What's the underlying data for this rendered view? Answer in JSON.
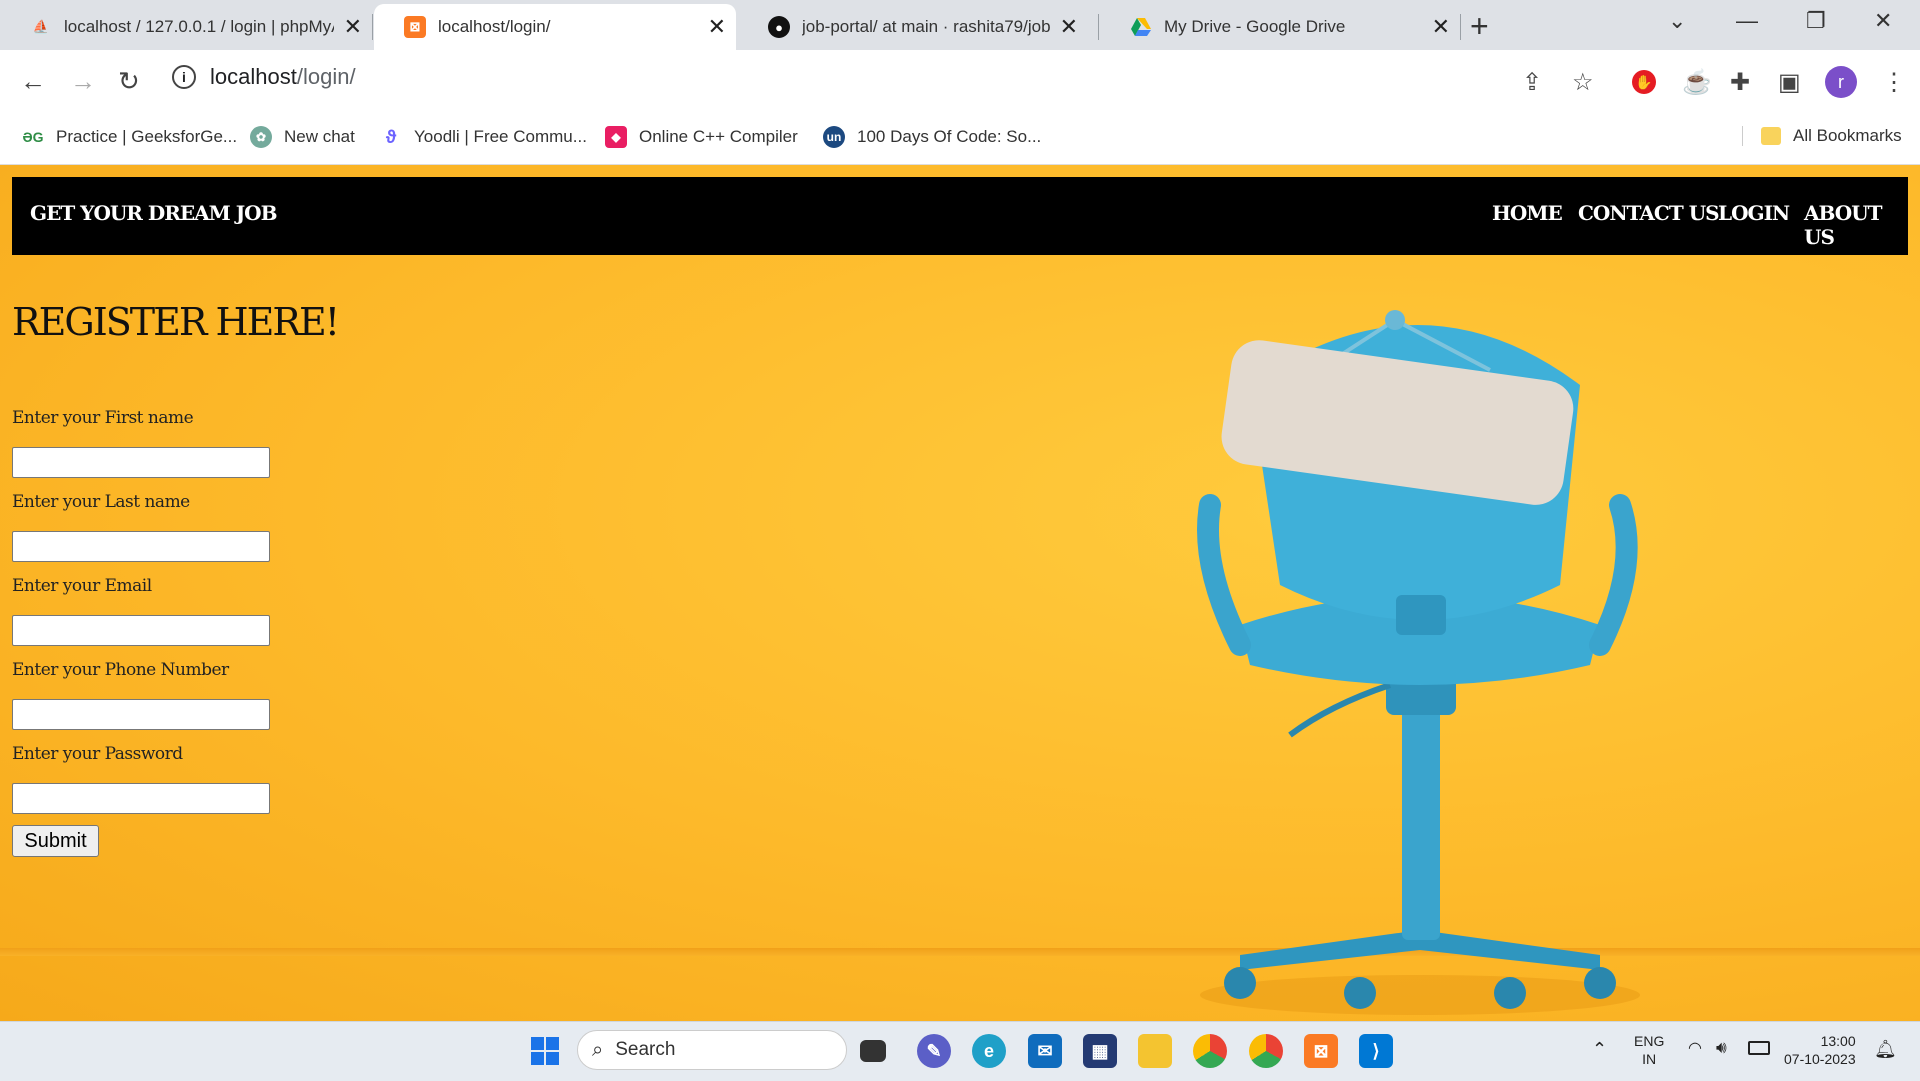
{
  "browser": {
    "tabs": [
      {
        "title": "localhost / 127.0.0.1 / login | phpMyAdmin",
        "icon": "phpmyadmin-icon",
        "active": false
      },
      {
        "title": "localhost/login/",
        "icon": "xampp-icon",
        "active": true
      },
      {
        "title": "job-portal/ at main · rashita79/job-portal",
        "icon": "github-icon",
        "active": false
      },
      {
        "title": "My Drive - Google Drive",
        "icon": "google-drive-icon",
        "active": false
      }
    ],
    "close_glyph": "✕",
    "new_tab_glyph": "+",
    "address": {
      "host": "localhost",
      "path": "/login/"
    },
    "profile_initial": "r",
    "bookmarks": [
      {
        "label": "Practice | GeeksforGe...",
        "icon": "geeksforgeeks-icon"
      },
      {
        "label": "New chat",
        "icon": "chatgpt-icon"
      },
      {
        "label": "Yoodli | Free Commu...",
        "icon": "yoodli-icon"
      },
      {
        "label": "Online C++ Compiler",
        "icon": "cpp-compiler-icon"
      },
      {
        "label": "100 Days Of Code: So...",
        "icon": "unstop-icon"
      }
    ],
    "all_bookmarks": "All Bookmarks"
  },
  "site": {
    "brand": "GET YOUR DREAM JOB",
    "nav": [
      "HOME",
      "CONTACT US",
      "LOGIN",
      "ABOUT US"
    ],
    "heading": "REGISTER HERE!",
    "fields": [
      {
        "label": "Enter your First name",
        "value": ""
      },
      {
        "label": "Enter your Last name",
        "value": ""
      },
      {
        "label": "Enter your Email",
        "value": ""
      },
      {
        "label": "Enter your Phone Number",
        "value": ""
      },
      {
        "label": "Enter your Password",
        "value": ""
      }
    ],
    "submit": "Submit",
    "colors": {
      "background": "#fdb92a",
      "navbar": "#000000",
      "chair": "#3ba7cf"
    }
  },
  "taskbar": {
    "search_placeholder": "Search",
    "language": "ENG",
    "region": "IN",
    "time": "13:00",
    "date": "07-10-2023"
  }
}
